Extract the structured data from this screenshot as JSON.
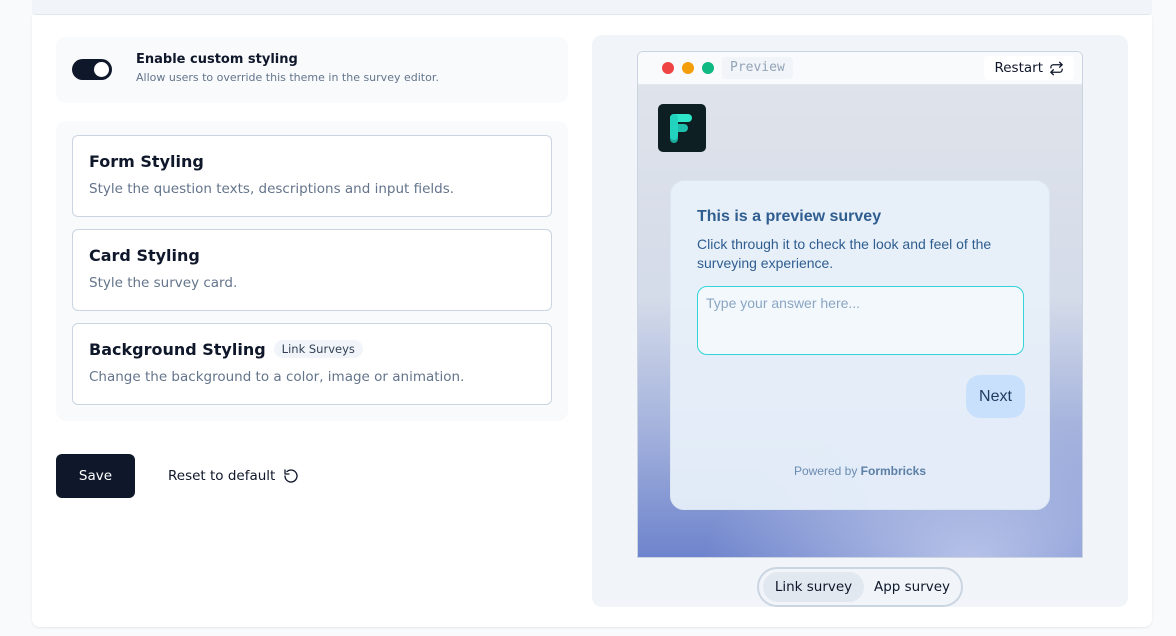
{
  "theme_toggle": {
    "title": "Enable custom styling",
    "description": "Allow users to override this theme in the survey editor.",
    "enabled": true
  },
  "styling_options": [
    {
      "title": "Form Styling",
      "description": "Style the question texts, descriptions and input fields.",
      "badge": ""
    },
    {
      "title": "Card Styling",
      "description": "Style the survey card.",
      "badge": ""
    },
    {
      "title": "Background Styling",
      "description": "Change the background to a color, image or animation.",
      "badge": "Link Surveys"
    }
  ],
  "actions": {
    "save_label": "Save",
    "reset_label": "Reset to default"
  },
  "preview": {
    "window_label": "Preview",
    "restart_label": "Restart",
    "survey": {
      "title": "This is a preview survey",
      "subtitle": "Click through it to check the look and feel of the surveying experience.",
      "input_placeholder": "Type your answer here...",
      "next_label": "Next",
      "powered_prefix": "Powered by",
      "powered_brand": "Formbricks"
    },
    "survey_types": [
      "Link survey",
      "App survey"
    ],
    "selected_type": "Link survey"
  },
  "colors": {
    "primary": "#0f172a",
    "accent_teal": "#34d4d9",
    "survey_text": "#2f5d8f",
    "dot_red": "#ef4444",
    "dot_yellow": "#f59e0b",
    "dot_green": "#10b981"
  },
  "icons": {
    "reset": "rotate-ccw-icon",
    "restart": "repeat-icon",
    "logo": "formbricks-logo"
  }
}
